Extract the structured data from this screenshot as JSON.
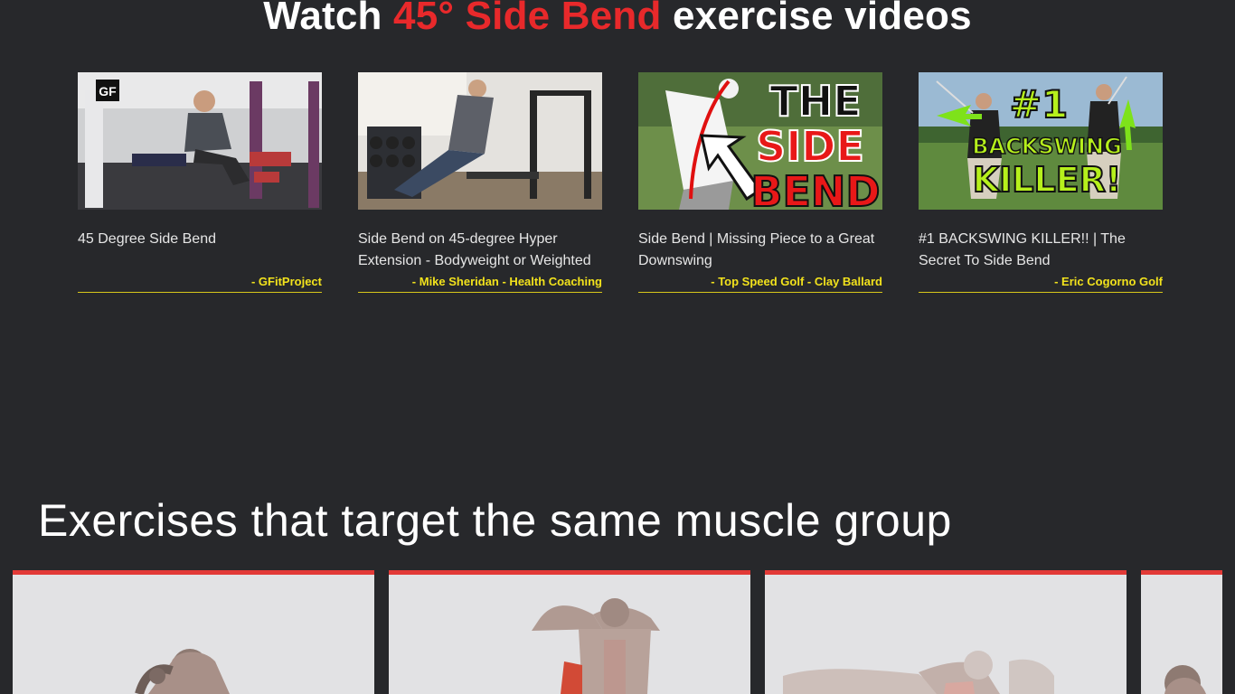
{
  "videos_section": {
    "heading_prefix": "Watch ",
    "heading_accent": "45° Side Bend",
    "heading_suffix": " exercise videos",
    "accent_color": "#e8292b",
    "videos": [
      {
        "title": "45 Degree Side Bend",
        "author": "- GFitProject",
        "thumbnail_icon": "gym-hyperextension-thumbnail",
        "thumbnail_badge": "GF"
      },
      {
        "title": "Side Bend on 45-degree Hyper Extension - Bodyweight or Weighted",
        "author": "- Mike Sheridan - Health Coaching",
        "thumbnail_icon": "home-gym-hyperextension-thumbnail"
      },
      {
        "title": "Side Bend | Missing Piece to a Great Downswing",
        "author": "- Top Speed Golf - Clay Ballard",
        "thumbnail_icon": "golf-side-bend-thumbnail",
        "thumbnail_text": [
          "THE",
          "SIDE",
          "BEND"
        ]
      },
      {
        "title": "#1 BACKSWING KILLER!! | The Secret To Side Bend",
        "author": "- Eric Cogorno Golf",
        "thumbnail_icon": "golf-backswing-thumbnail",
        "thumbnail_text": [
          "#1",
          "BACKSWING",
          "KILLER!"
        ]
      }
    ]
  },
  "exercises_section": {
    "heading": "Exercises that target the same muscle group",
    "card_accent_color": "#e23a37",
    "cards": [
      {
        "image_icon": "side-crunch-figure-illustration"
      },
      {
        "image_icon": "oblique-crunch-figure-illustration"
      },
      {
        "image_icon": "lying-twist-figure-illustration"
      },
      {
        "image_icon": "partial-figure-illustration"
      }
    ]
  }
}
